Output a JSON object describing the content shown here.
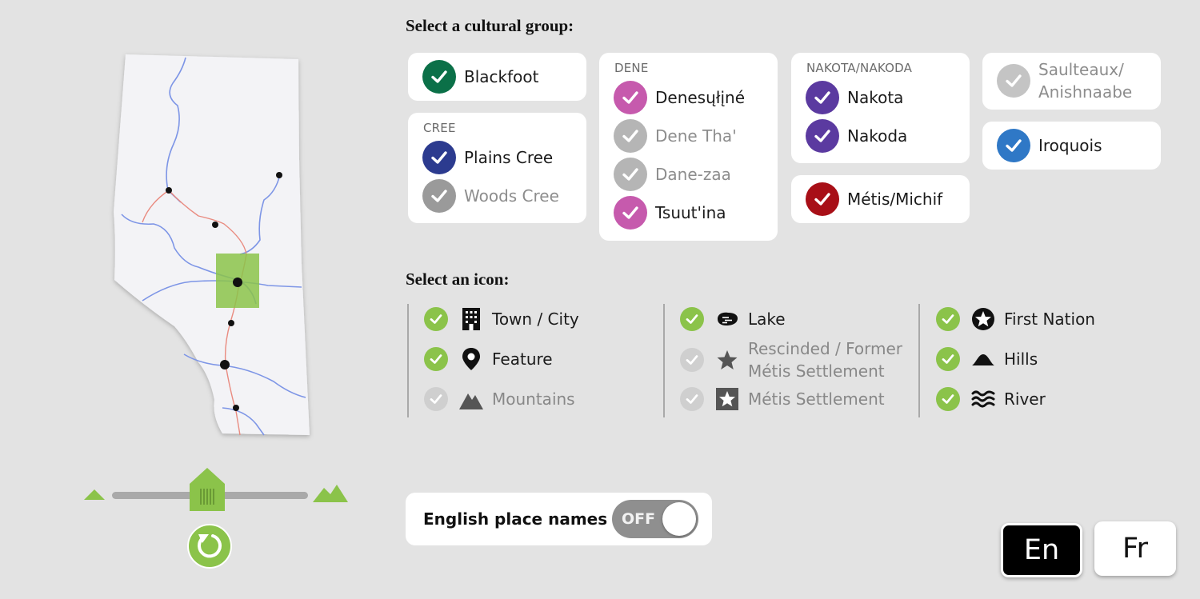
{
  "headings": {
    "cultural_group": "Select a cultural group:",
    "icon": "Select an icon:"
  },
  "groups": {
    "blackfoot": {
      "label": "Blackfoot",
      "selected": true,
      "color": "#0b7048"
    },
    "cree": {
      "title": "CREE",
      "items": [
        {
          "label": "Plains Cree",
          "selected": true,
          "color": "#2c3b8f"
        },
        {
          "label": "Woods Cree",
          "selected": false,
          "color": "#9a9a9a"
        }
      ]
    },
    "dene": {
      "title": "DENE",
      "items": [
        {
          "label": "Denesųłįné",
          "selected": true,
          "color": "#c65aad"
        },
        {
          "label": "Dene Tha'",
          "selected": false,
          "color": "#b5b5b5"
        },
        {
          "label": "Dane-zaa",
          "selected": false,
          "color": "#b5b5b5"
        },
        {
          "label": "Tsuut'ina",
          "selected": true,
          "color": "#c65aad"
        }
      ]
    },
    "nakota": {
      "title": "NAKOTA/NAKODA",
      "items": [
        {
          "label": "Nakota",
          "selected": true,
          "color": "#5b3aa0"
        },
        {
          "label": "Nakoda",
          "selected": true,
          "color": "#5b3aa0"
        }
      ]
    },
    "metis": {
      "label": "Métis/Michif",
      "selected": true,
      "color": "#a80f17"
    },
    "saulteaux": {
      "line1": "Saulteaux/",
      "line2": "Anishnaabe",
      "selected": false,
      "color": "#c4c4c4"
    },
    "iroquois": {
      "label": "Iroquois",
      "selected": true,
      "color": "#2f78c6"
    }
  },
  "icons": {
    "col1": [
      {
        "label": "Town / City",
        "selected": true,
        "icon": "building-icon"
      },
      {
        "label": "Feature",
        "selected": true,
        "icon": "map-pin-icon"
      },
      {
        "label": "Mountains",
        "selected": false,
        "icon": "mountains-icon"
      }
    ],
    "col2": [
      {
        "label": "Lake",
        "selected": true,
        "icon": "lake-icon"
      },
      {
        "label_line1": "Rescinded / Former",
        "label_line2": "Métis Settlement",
        "selected": false,
        "icon": "star-icon"
      },
      {
        "label": "Métis Settlement",
        "selected": false,
        "icon": "star-square-icon"
      }
    ],
    "col3": [
      {
        "label": "First Nation",
        "selected": true,
        "icon": "star-circle-icon"
      },
      {
        "label": "Hills",
        "selected": true,
        "icon": "hill-icon"
      },
      {
        "label": "River",
        "selected": true,
        "icon": "waves-icon"
      }
    ]
  },
  "check_on_color": "#8bc34a",
  "check_off_color": "#cfcfcf",
  "toggle": {
    "label": "English place names",
    "state": "OFF"
  },
  "language": {
    "en": "En",
    "fr": "Fr",
    "active": "En"
  },
  "map": {
    "highlight_color": "#8bc34a",
    "river_color": "#7d95e6",
    "road_color": "#e98b80"
  }
}
